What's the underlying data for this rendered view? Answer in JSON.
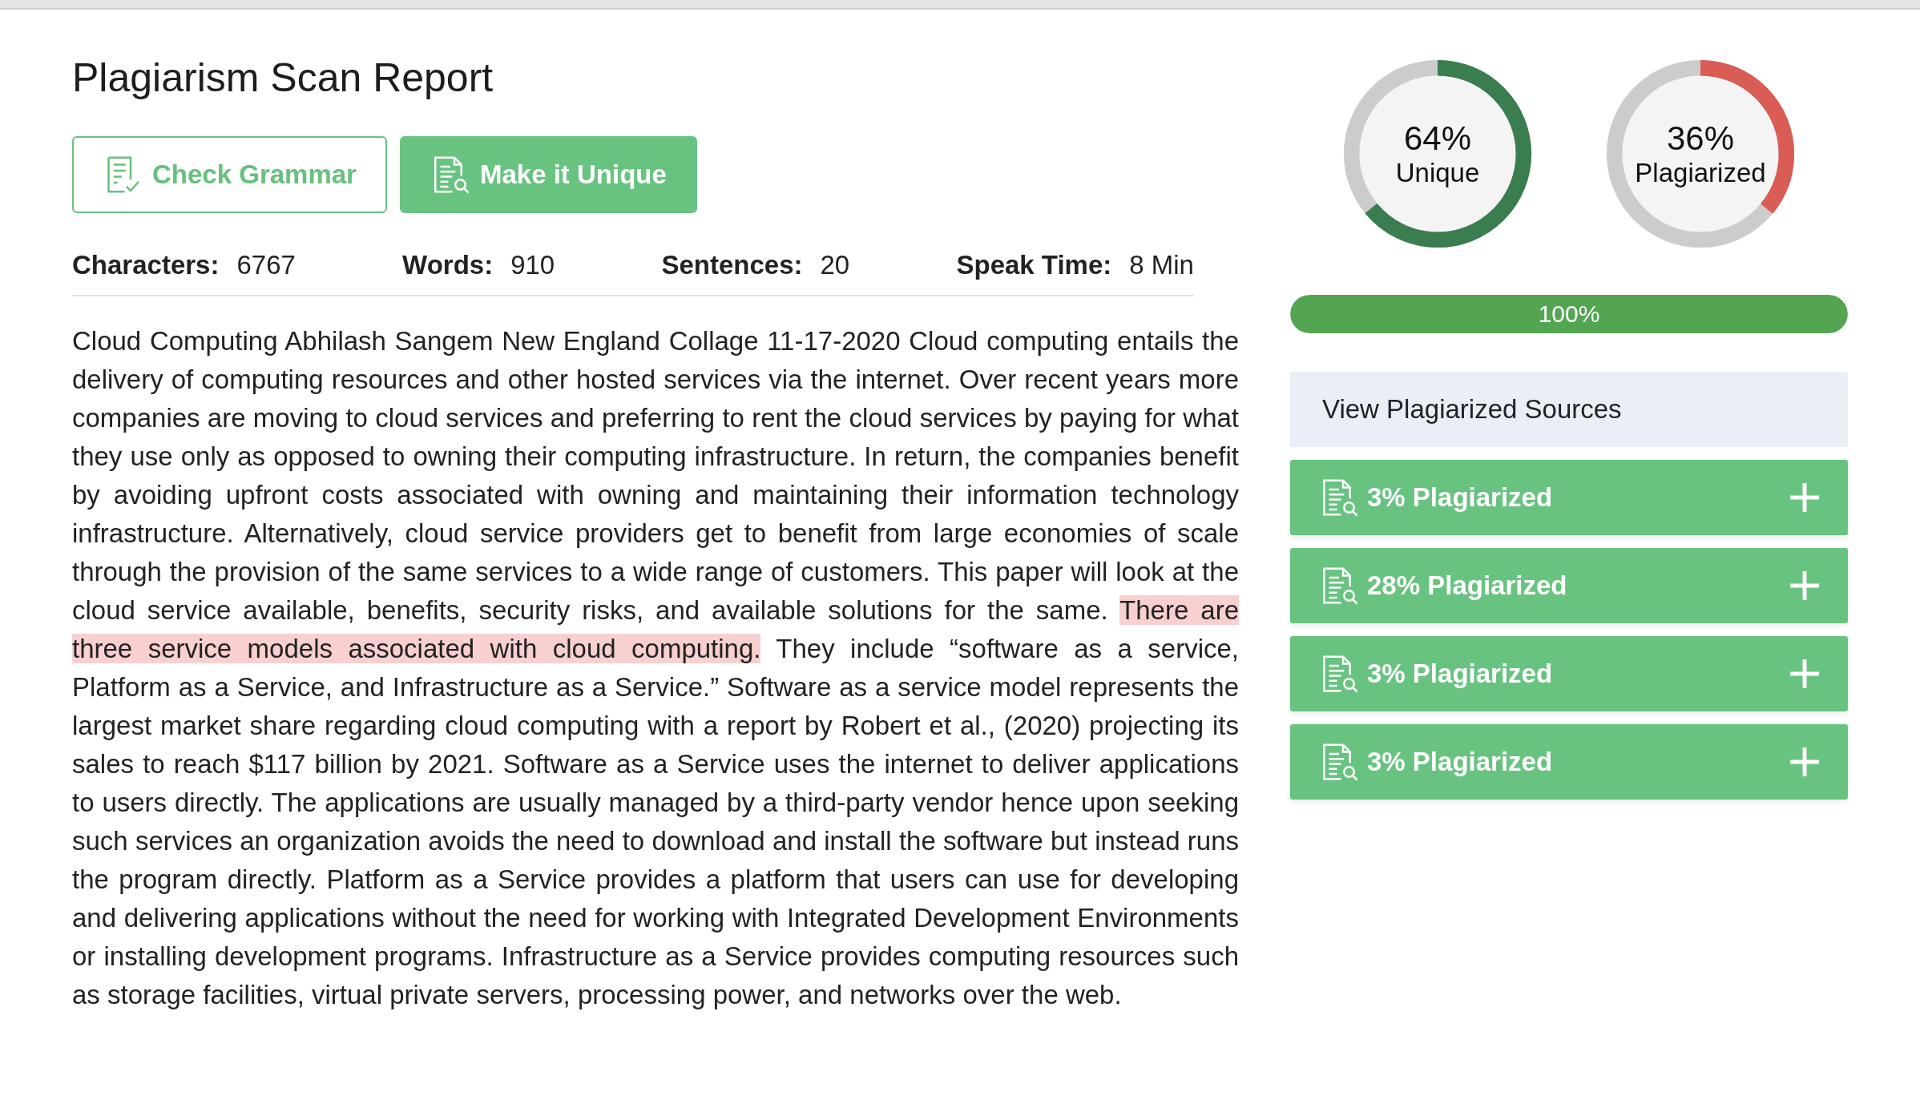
{
  "title": "Plagiarism Scan Report",
  "actions": [
    {
      "label": "Check Grammar",
      "kind": "outline"
    },
    {
      "label": "Make it Unique",
      "kind": "filled"
    }
  ],
  "stats": [
    {
      "label": "Characters:",
      "value": "6767"
    },
    {
      "label": "Words:",
      "value": "910"
    },
    {
      "label": "Sentences:",
      "value": "20"
    },
    {
      "label": "Speak Time:",
      "value": "8 Min"
    }
  ],
  "body": [
    {
      "text": "Cloud Computing Abhilash Sangem New England Collage 11-17-2020      Cloud computing entails the delivery of computing resources and other hosted services via the internet. Over recent years more companies are moving to cloud services and preferring to rent the cloud services by paying for what they use only as opposed to owning their computing infrastructure. In return, the companies benefit by avoiding upfront costs associated with owning and maintaining their information technology infrastructure. Alternatively, cloud service providers get to benefit from large economies of scale through the provision of the same services to a wide range of customers. This paper will look at the cloud service available, benefits, security risks, and available solutions for the same. ",
      "highlighted": false
    },
    {
      "text": "There are three service models associated with cloud computing.",
      "highlighted": true
    },
    {
      "text": " They include “software as a service, Platform as a Service, and Infrastructure as a Service.” Software as a service model represents the largest market share regarding cloud computing with a report by Robert et al., (2020) projecting its sales to reach $117 billion by 2021. Software as a Service uses the internet to deliver applications to users directly. The applications are usually managed by a third-party vendor hence upon seeking such services an organization avoids the need to download and install the software but instead runs the program directly. Platform as a Service provides a platform that users can use for developing and delivering applications without the need for working with Integrated Development Environments or installing development programs. Infrastructure as a Service provides computing resources such as storage facilities, virtual private servers, processing power, and networks over the web.",
      "highlighted": false
    }
  ],
  "scores": [
    {
      "value": "64%",
      "label": "Unique",
      "level": 0.64,
      "color": "#3a7d4f"
    },
    {
      "value": "36%",
      "label": "Plagiarized",
      "level": 0.36,
      "color": "#d95c55"
    }
  ],
  "progress": {
    "level": 1.0,
    "reading": "100%"
  },
  "sources_header": "View Plagiarized Sources",
  "sources": [
    {
      "label": "3% Plagiarized"
    },
    {
      "label": "28% Plagiarized"
    },
    {
      "label": "3% Plagiarized"
    },
    {
      "label": "3% Plagiarized"
    }
  ]
}
